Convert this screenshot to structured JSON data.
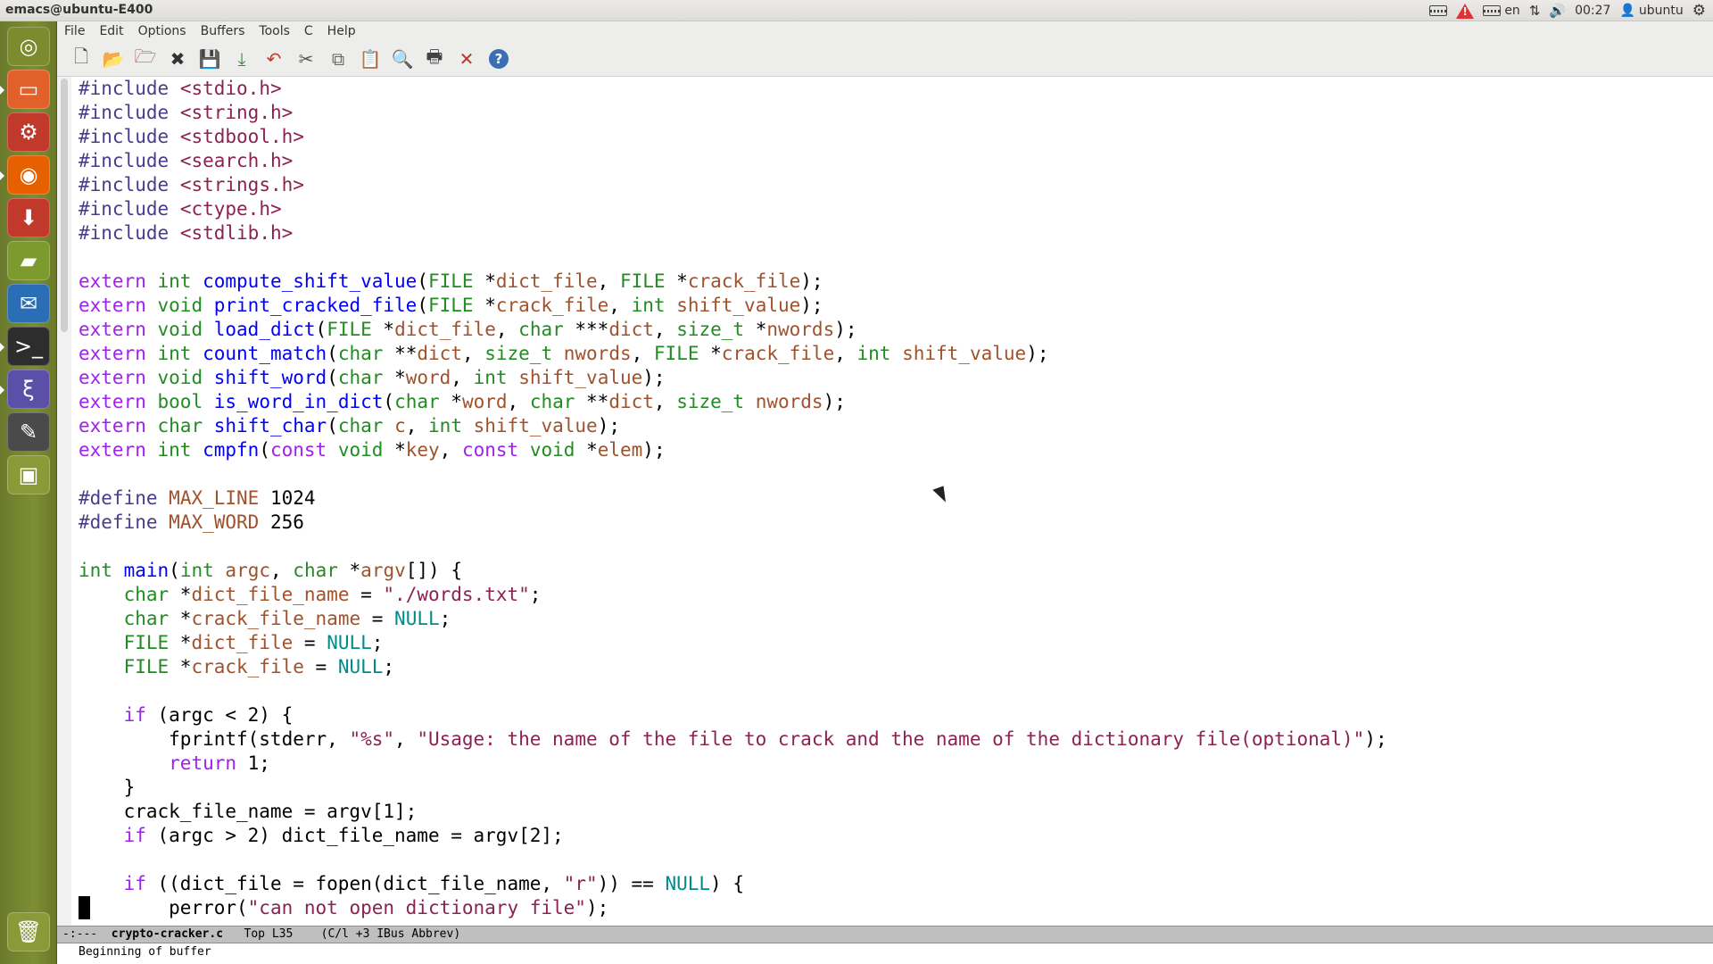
{
  "window": {
    "title": "emacs@ubuntu-E400"
  },
  "panel": {
    "language": "en",
    "clock": "00:27",
    "user": "ubuntu"
  },
  "launcher": {
    "items": [
      {
        "name": "dash-home",
        "icon": "ubuntu-logo-icon",
        "color": "#7c8b2e"
      },
      {
        "name": "files",
        "icon": "folder-icon",
        "color": "#e2612a"
      },
      {
        "name": "system-settings",
        "icon": "settings-icon",
        "color": "#c0392b"
      },
      {
        "name": "firefox",
        "icon": "firefox-icon",
        "color": "#e66000"
      },
      {
        "name": "software-center",
        "icon": "software-center-icon",
        "color": "#c0392b"
      },
      {
        "name": "app-green",
        "icon": "book-icon",
        "color": "#7c9a2e"
      },
      {
        "name": "thunderbird",
        "icon": "thunderbird-icon",
        "color": "#2a6fb5"
      },
      {
        "name": "terminal",
        "icon": "terminal-icon",
        "color": "#2d2d2d"
      },
      {
        "name": "emacs",
        "icon": "emacs-icon",
        "color": "#5b4fa8"
      },
      {
        "name": "text-editor",
        "icon": "text-editor-icon",
        "color": "#4a4a4a"
      },
      {
        "name": "workspace-switcher",
        "icon": "workspace-icon",
        "color": "#8a9a38"
      },
      {
        "name": "trash",
        "icon": "trash-icon",
        "color": "#8a9a38"
      }
    ]
  },
  "menubar": [
    "File",
    "Edit",
    "Options",
    "Buffers",
    "Tools",
    "C",
    "Help"
  ],
  "toolbar": [
    "new-file-icon",
    "open-folder-icon",
    "open-dired-icon",
    "close-icon",
    "save-icon",
    "save-as-icon",
    "undo-icon",
    "cut-icon",
    "copy-icon",
    "paste-icon",
    "search-icon",
    "print-icon",
    "preferences-icon",
    "help-icon"
  ],
  "code": [
    "#include <stdio.h>",
    "#include <string.h>",
    "#include <stdbool.h>",
    "#include <search.h>",
    "#include <strings.h>",
    "#include <ctype.h>",
    "#include <stdlib.h>",
    "",
    "extern int compute_shift_value(FILE *dict_file, FILE *crack_file);",
    "extern void print_cracked_file(FILE *crack_file, int shift_value);",
    "extern void load_dict(FILE *dict_file, char ***dict, size_t *nwords);",
    "extern int count_match(char **dict, size_t nwords, FILE *crack_file, int shift_value);",
    "extern void shift_word(char *word, int shift_value);",
    "extern bool is_word_in_dict(char *word, char **dict, size_t nwords);",
    "extern char shift_char(char c, int shift_value);",
    "extern int cmpfn(const void *key, const void *elem);",
    "",
    "#define MAX_LINE 1024",
    "#define MAX_WORD 256",
    "",
    "int main(int argc, char *argv[]) {",
    "    char *dict_file_name = \"./words.txt\";",
    "    char *crack_file_name = NULL;",
    "    FILE *dict_file = NULL;",
    "    FILE *crack_file = NULL;",
    "",
    "    if (argc < 2) {",
    "        fprintf(stderr, \"%s\", \"Usage: the name of the file to crack and the name of the dictionary file(optional)\");",
    "        return 1;",
    "    }",
    "    crack_file_name = argv[1];",
    "    if (argc > 2) dict_file_name = argv[2];",
    "",
    "    if ((dict_file = fopen(dict_file_name, \"r\")) == NULL) {",
    "        perror(\"can not open dictionary file\");"
  ],
  "modeline": {
    "prefix": "-:---  ",
    "buffer": "crypto-cracker.c",
    "position": "   Top L35",
    "modes": "    (C/l +3 IBus Abbrev)"
  },
  "echo": "Beginning of buffer",
  "colors": {
    "keyword": "#a020f0",
    "type": "#228b22",
    "function": "#0000ff",
    "variable": "#a0522d",
    "string": "#8b2252",
    "constant": "#008b8b",
    "preprocessor": "#483d8b"
  }
}
